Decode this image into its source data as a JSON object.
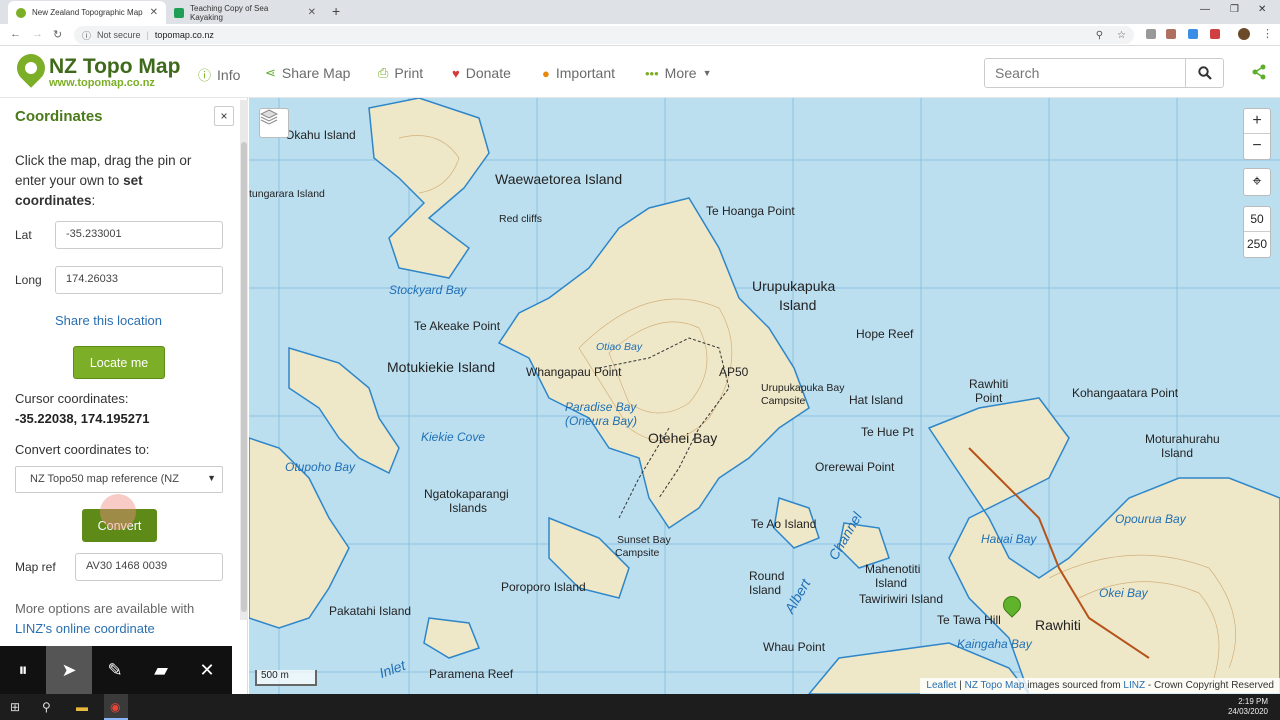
{
  "browser": {
    "tabs": [
      {
        "label": "New Zealand Topographic Map",
        "close": "✕"
      },
      {
        "label": "Teaching Copy of Sea Kayaking",
        "close": "✕"
      }
    ],
    "new_tab": "+",
    "security_label": "Not secure",
    "url": "topomap.co.nz"
  },
  "header": {
    "logo_title": "NZ Topo Map",
    "logo_subtitle": "www.topomap.co.nz",
    "menu": {
      "info": "Info",
      "share_map": "Share Map",
      "print": "Print",
      "donate": "Donate",
      "important": "Important",
      "more": "More"
    },
    "search_placeholder": "Search"
  },
  "sidebar": {
    "title": "Coordinates",
    "close": "×",
    "intro_prefix": "Click the map, drag the pin or enter your own to",
    "intro_bold": "set coordinates",
    "intro_suffix": ":",
    "lat_label": "Lat",
    "lat_value": "-35.233001",
    "long_label": "Long",
    "long_value": "174.26033",
    "share_link": "Share this location",
    "locate_button": "Locate me",
    "cursor_label": "Cursor coordinates:",
    "cursor_value": "-35.22038, 174.195271",
    "convert_label": "Convert coordinates to:",
    "convert_selected": "NZ Topo50 map reference (NZ",
    "convert_button": "Convert",
    "mapref_label": "Map ref",
    "mapref_value": "AV30 1468 0039",
    "more_options": "More options are available with",
    "linz_link": "LINZ's online coordinate"
  },
  "map": {
    "zoom_in": "+",
    "zoom_out": "−",
    "scale_50": "50",
    "scale_250": "250",
    "scalebar": "500 m",
    "attribution": {
      "leaflet": "Leaflet",
      "sep": " | ",
      "nztopo": "NZ Topo Map",
      "images_text": " images sourced from ",
      "linz": "LINZ",
      "crown": " - Crown Copyright Reserved"
    },
    "labels": [
      "Okahu Island",
      "tungarara Island",
      "Waewaetorea Island",
      "Red cliffs",
      "Te Hoanga Point",
      "Urupukapuka",
      "Island",
      "Stockyard Bay",
      "Te Akeake Point",
      "Hope Reef",
      "Motukiekie Island",
      "Otiao Bay",
      "Whangapau Point",
      "AP50",
      "Urupukapuka Bay",
      "Campsite",
      "Hat Island",
      "Rawhiti",
      "Point",
      "Kohangaatara Point",
      "Paradise Bay",
      "(Oneura Bay)",
      "Otehei Bay",
      "Te Hue Pt",
      "Kiekie Cove",
      "Moturahurahu",
      "Island",
      "Otupoho Bay",
      "Orerewai Point",
      "Ngatokaparangi",
      "Islands",
      "Opourua Bay",
      "Hauai Bay",
      "Te Ao Island",
      "Sunset Bay",
      "Campsite",
      "Okei Bay",
      "Mahenotiti",
      "Island",
      "Round",
      "Island",
      "Poroporo Island",
      "Pakatahi Island",
      "Tawiriwiri Island",
      "Te Tawa Hill",
      "Rawhiti",
      "Kaingaha Bay",
      "Whau Point",
      "Paramena Reef",
      "Inlet",
      "Albert",
      "Channel"
    ]
  },
  "annotation_toolbar": {
    "pause": "⏸",
    "pointer": "➤",
    "pen": "✎",
    "marker": "▰",
    "close": "✕"
  },
  "taskbar": {
    "time": "2:19 PM",
    "date": "24/03/2020"
  },
  "colors": {
    "brand_green": "#7cae27",
    "brand_dark": "#3f6a1b",
    "link_blue": "#2a6fb0",
    "sea": "#bcdff0",
    "land": "#efe8c8"
  }
}
